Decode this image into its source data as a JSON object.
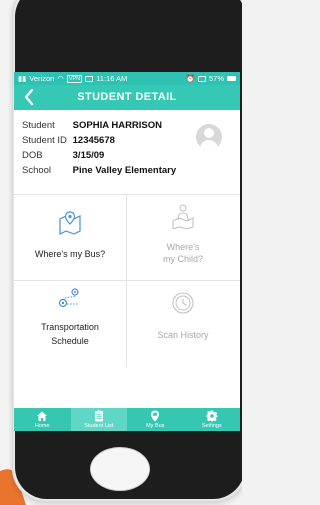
{
  "status": {
    "carrier": "Verizon",
    "vpn": "VPN",
    "time": "11:16 AM",
    "battery": "57%"
  },
  "nav": {
    "back": "<",
    "title": "STUDENT DETAIL"
  },
  "student": {
    "student_label": "Student",
    "student_value": "SOPHIA HARRISON",
    "id_label": "Student ID",
    "id_value": "12345678",
    "dob_label": "DOB",
    "dob_value": "3/15/09",
    "school_label": "School",
    "school_value": "Pine Valley Elementary"
  },
  "tiles": {
    "bus": {
      "label": "Where's my Bus?",
      "icon": "map-pin-icon"
    },
    "child_line1": "Where's",
    "child_line2": "my Child?",
    "child_icon": "child-location-icon",
    "schedule_line1": "Transportation",
    "schedule_line2": "Schedule",
    "schedule_icon": "route-icon",
    "history": {
      "label": "Scan History",
      "icon": "clock-icon"
    }
  },
  "tabs": [
    {
      "label": "Home",
      "icon": "home-icon"
    },
    {
      "label": "Student List",
      "icon": "list-icon"
    },
    {
      "label": "My Bus",
      "icon": "bus-icon"
    },
    {
      "label": "Settings",
      "icon": "gear-icon"
    }
  ],
  "colors": {
    "teal": "#35c8b5",
    "teal_active": "#5fd6c6",
    "disabled_text": "#a8a8a8"
  }
}
